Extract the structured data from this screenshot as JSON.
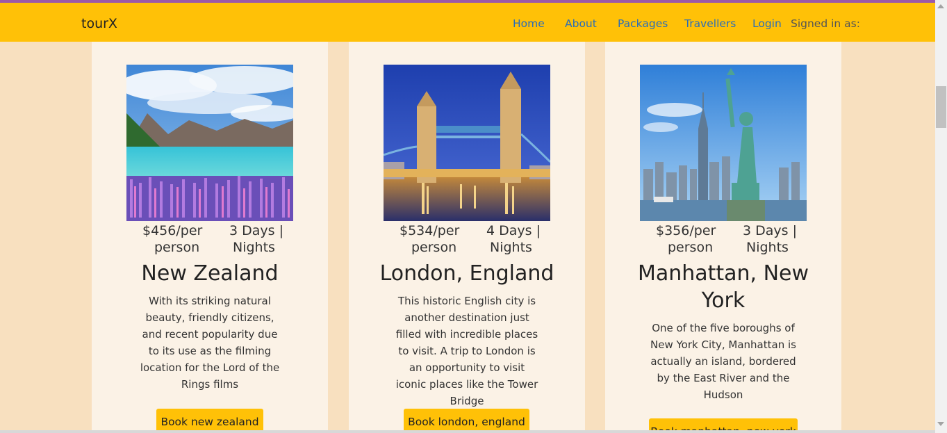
{
  "brand": "tourX",
  "nav": {
    "home": "Home",
    "about": "About",
    "packages": "Packages",
    "travellers": "Travellers",
    "login": "Login",
    "signed_in": "Signed in as:"
  },
  "packages": [
    {
      "price_line1": "$456/per",
      "price_line2": "person",
      "duration_line1": "3 Days |",
      "duration_line2": "Nights",
      "title": "New Zealand",
      "description": "With its striking natural beauty, friendly citizens, and recent popularity due to its use as the filming location for the Lord of the Rings films",
      "button": "Book new zealand"
    },
    {
      "price_line1": "$534/per",
      "price_line2": "person",
      "duration_line1": "4 Days |",
      "duration_line2": "Nights",
      "title": "London, England",
      "description": "This historic English city is another destination just filled with incredible places to visit. A trip to London is an opportunity to visit iconic places like the Tower Bridge",
      "button": "Book london, england"
    },
    {
      "price_line1": "$356/per",
      "price_line2": "person",
      "duration_line1": "3 Days |",
      "duration_line2": "Nights",
      "title": "Manhattan, New York",
      "description": "One of the five boroughs of New York City, Manhattan is actually an island, bordered by the East River and the Hudson",
      "button": "Book manhattan, new york"
    }
  ],
  "colors": {
    "navbar": "#ffc107",
    "page_background": "#f8e0bf",
    "card_background": "#fbf2e6",
    "link": "#2a6db8"
  }
}
